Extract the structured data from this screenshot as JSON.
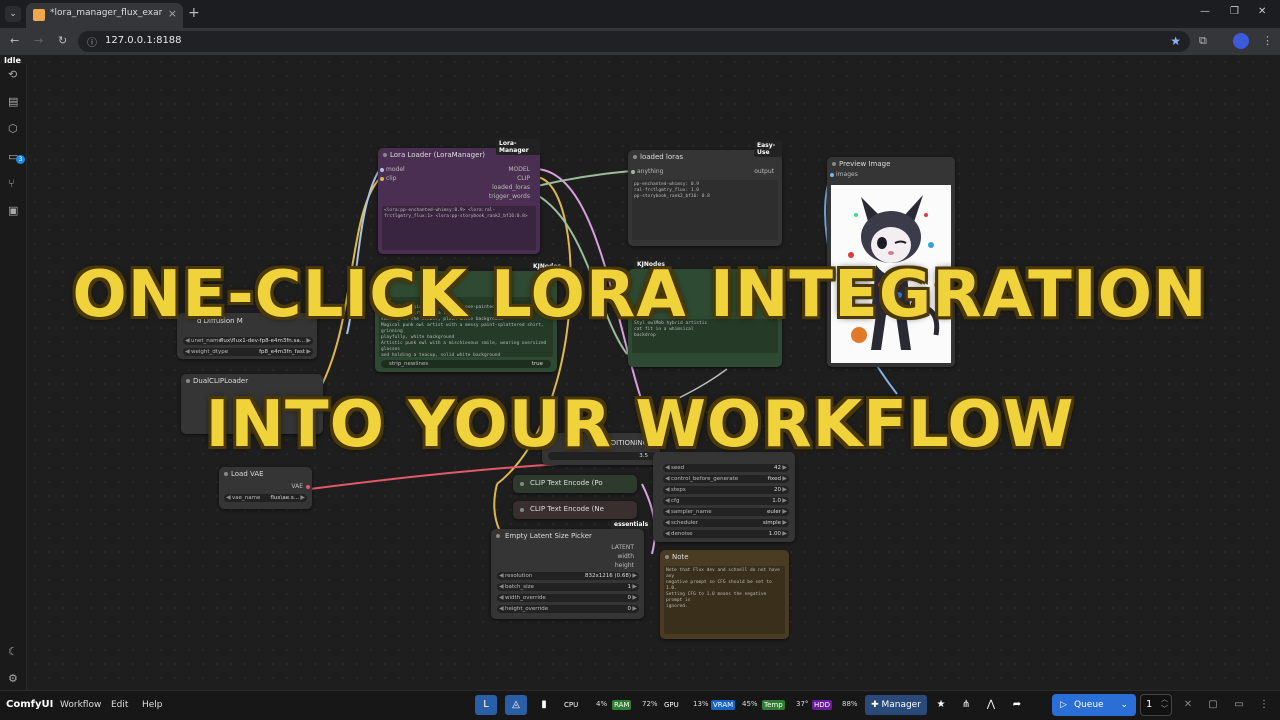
{
  "browser": {
    "tab_title": "*lora_manager_flux_example",
    "url": "127.0.0.1:8188"
  },
  "app": {
    "status": "Idle",
    "queue_badge": "3"
  },
  "nodes": {
    "lora_loader": {
      "badge": "Lora-Manager",
      "title": "Lora Loader (LoraManager)",
      "inputs": [
        "model",
        "clip"
      ],
      "outputs": [
        "MODEL",
        "CLIP",
        "loaded_loras",
        "trigger_words"
      ],
      "text": "<lora:pp-enchanted-whimsy:0.9> <lora:ral-frctlgmtry_flux:1> <lora:pp-storybook_rank2_bf16:0.8>"
    },
    "loaded_loras": {
      "badge": "Easy-Use",
      "title": "loaded loras",
      "input": "anything",
      "output": "output",
      "text": "pp-enchanted-whimsy: 0.9\nral-frctlgmtry_flux: 1.0\npp-storybook_rank2_bf16: 0.8"
    },
    "preview": {
      "title": "Preview Image",
      "input": "images"
    },
    "unet_loader": {
      "title": "d Diffusion M",
      "unet_label": "unet_name",
      "unet_value": "flux\\flux1-dev-fp8-e4m3fn.sa...",
      "dtype_label": "weight_dtype",
      "dtype_value": "fp8_e4m3fn_fast"
    },
    "text_node": {
      "badge": "KJNodes",
      "text": "Styl\nA playful magical girl with a nose-painted pointed\nwhimsical shirt with a toast,\nsmiling at the viewer, plain white background\nMagical punk owl artist with a messy paint-splattered shirt, grinning\nplayfully, white background\nArtistic punk owl with a mischievous smile, wearing oversized glasses\nand holding a teacup, solid white background",
      "widget_label": "strip_newlines",
      "widget_value": "true"
    },
    "prompt_node": {
      "badge": "KJNodes",
      "text": "Styl owlMob hybrid artistic\ncat fit in a whimsical\nbackdrop"
    },
    "dual_clip": {
      "title": "DualCLIPLoader"
    },
    "load_vae": {
      "title": "Load VAE",
      "output": "VAE",
      "vae_label": "vae_name",
      "vae_value": "flux\\ae.s..."
    },
    "conditioning": {
      "title": "ONDITIONING",
      "value": "3.5"
    },
    "clip_encode_pos": {
      "title": "CLIP Text Encode (Po"
    },
    "clip_encode_neg": {
      "title": "CLIP Text Encode (Ne"
    },
    "sampler": {
      "widgets": [
        {
          "label": "seed",
          "value": "42"
        },
        {
          "label": "control_before_generate",
          "value": "fixed"
        },
        {
          "label": "steps",
          "value": "20"
        },
        {
          "label": "cfg",
          "value": "1.0"
        },
        {
          "label": "sampler_name",
          "value": "euler"
        },
        {
          "label": "scheduler",
          "value": "simple"
        },
        {
          "label": "denoise",
          "value": "1.00"
        }
      ]
    },
    "latent": {
      "badge": "essentials",
      "title": "Empty Latent Size Picker",
      "outputs": [
        "LATENT",
        "width",
        "height"
      ],
      "widgets": [
        {
          "label": "resolution",
          "value": "832x1216 (0.68)"
        },
        {
          "label": "batch_size",
          "value": "1"
        },
        {
          "label": "width_override",
          "value": "0"
        },
        {
          "label": "height_override",
          "value": "0"
        }
      ]
    },
    "note": {
      "title": "Note",
      "text": "Note that Flux dev and schnell do not have any\nnegative prompt so CFG should be set to 1.0.\nSetting CFG to 1.0 means the negative prompt is\nignored."
    }
  },
  "headline": {
    "line1": "ONE-CLICK LORA INTEGRATION",
    "line2": "INTO YOUR WORKFLOW"
  },
  "menu": {
    "brand": "ComfyUI",
    "items": [
      "Workflow",
      "Edit",
      "Help"
    ]
  },
  "stats": [
    {
      "label": "CPU",
      "value": "4%",
      "color": "#2a2a2a"
    },
    {
      "label": "RAM",
      "value": "72%",
      "color": "#2e7d32"
    },
    {
      "label": "GPU",
      "value": "13%",
      "color": "#2a2a2a"
    },
    {
      "label": "VRAM",
      "value": "45%",
      "color": "#1565c0"
    },
    {
      "label": "Temp",
      "value": "37°",
      "color": "#2e7d32"
    },
    {
      "label": "HDD",
      "value": "88%",
      "color": "#6a1b9a"
    }
  ],
  "toolbar": {
    "manager_label": "Manager",
    "queue_label": "Queue",
    "queue_count": "1"
  },
  "colors": {
    "headline": "#f0d33a",
    "lora_node": "#4a2f52",
    "green_node": "#2f4a32",
    "note_node": "#4a3c22",
    "queue_button": "#2b6fd6"
  }
}
